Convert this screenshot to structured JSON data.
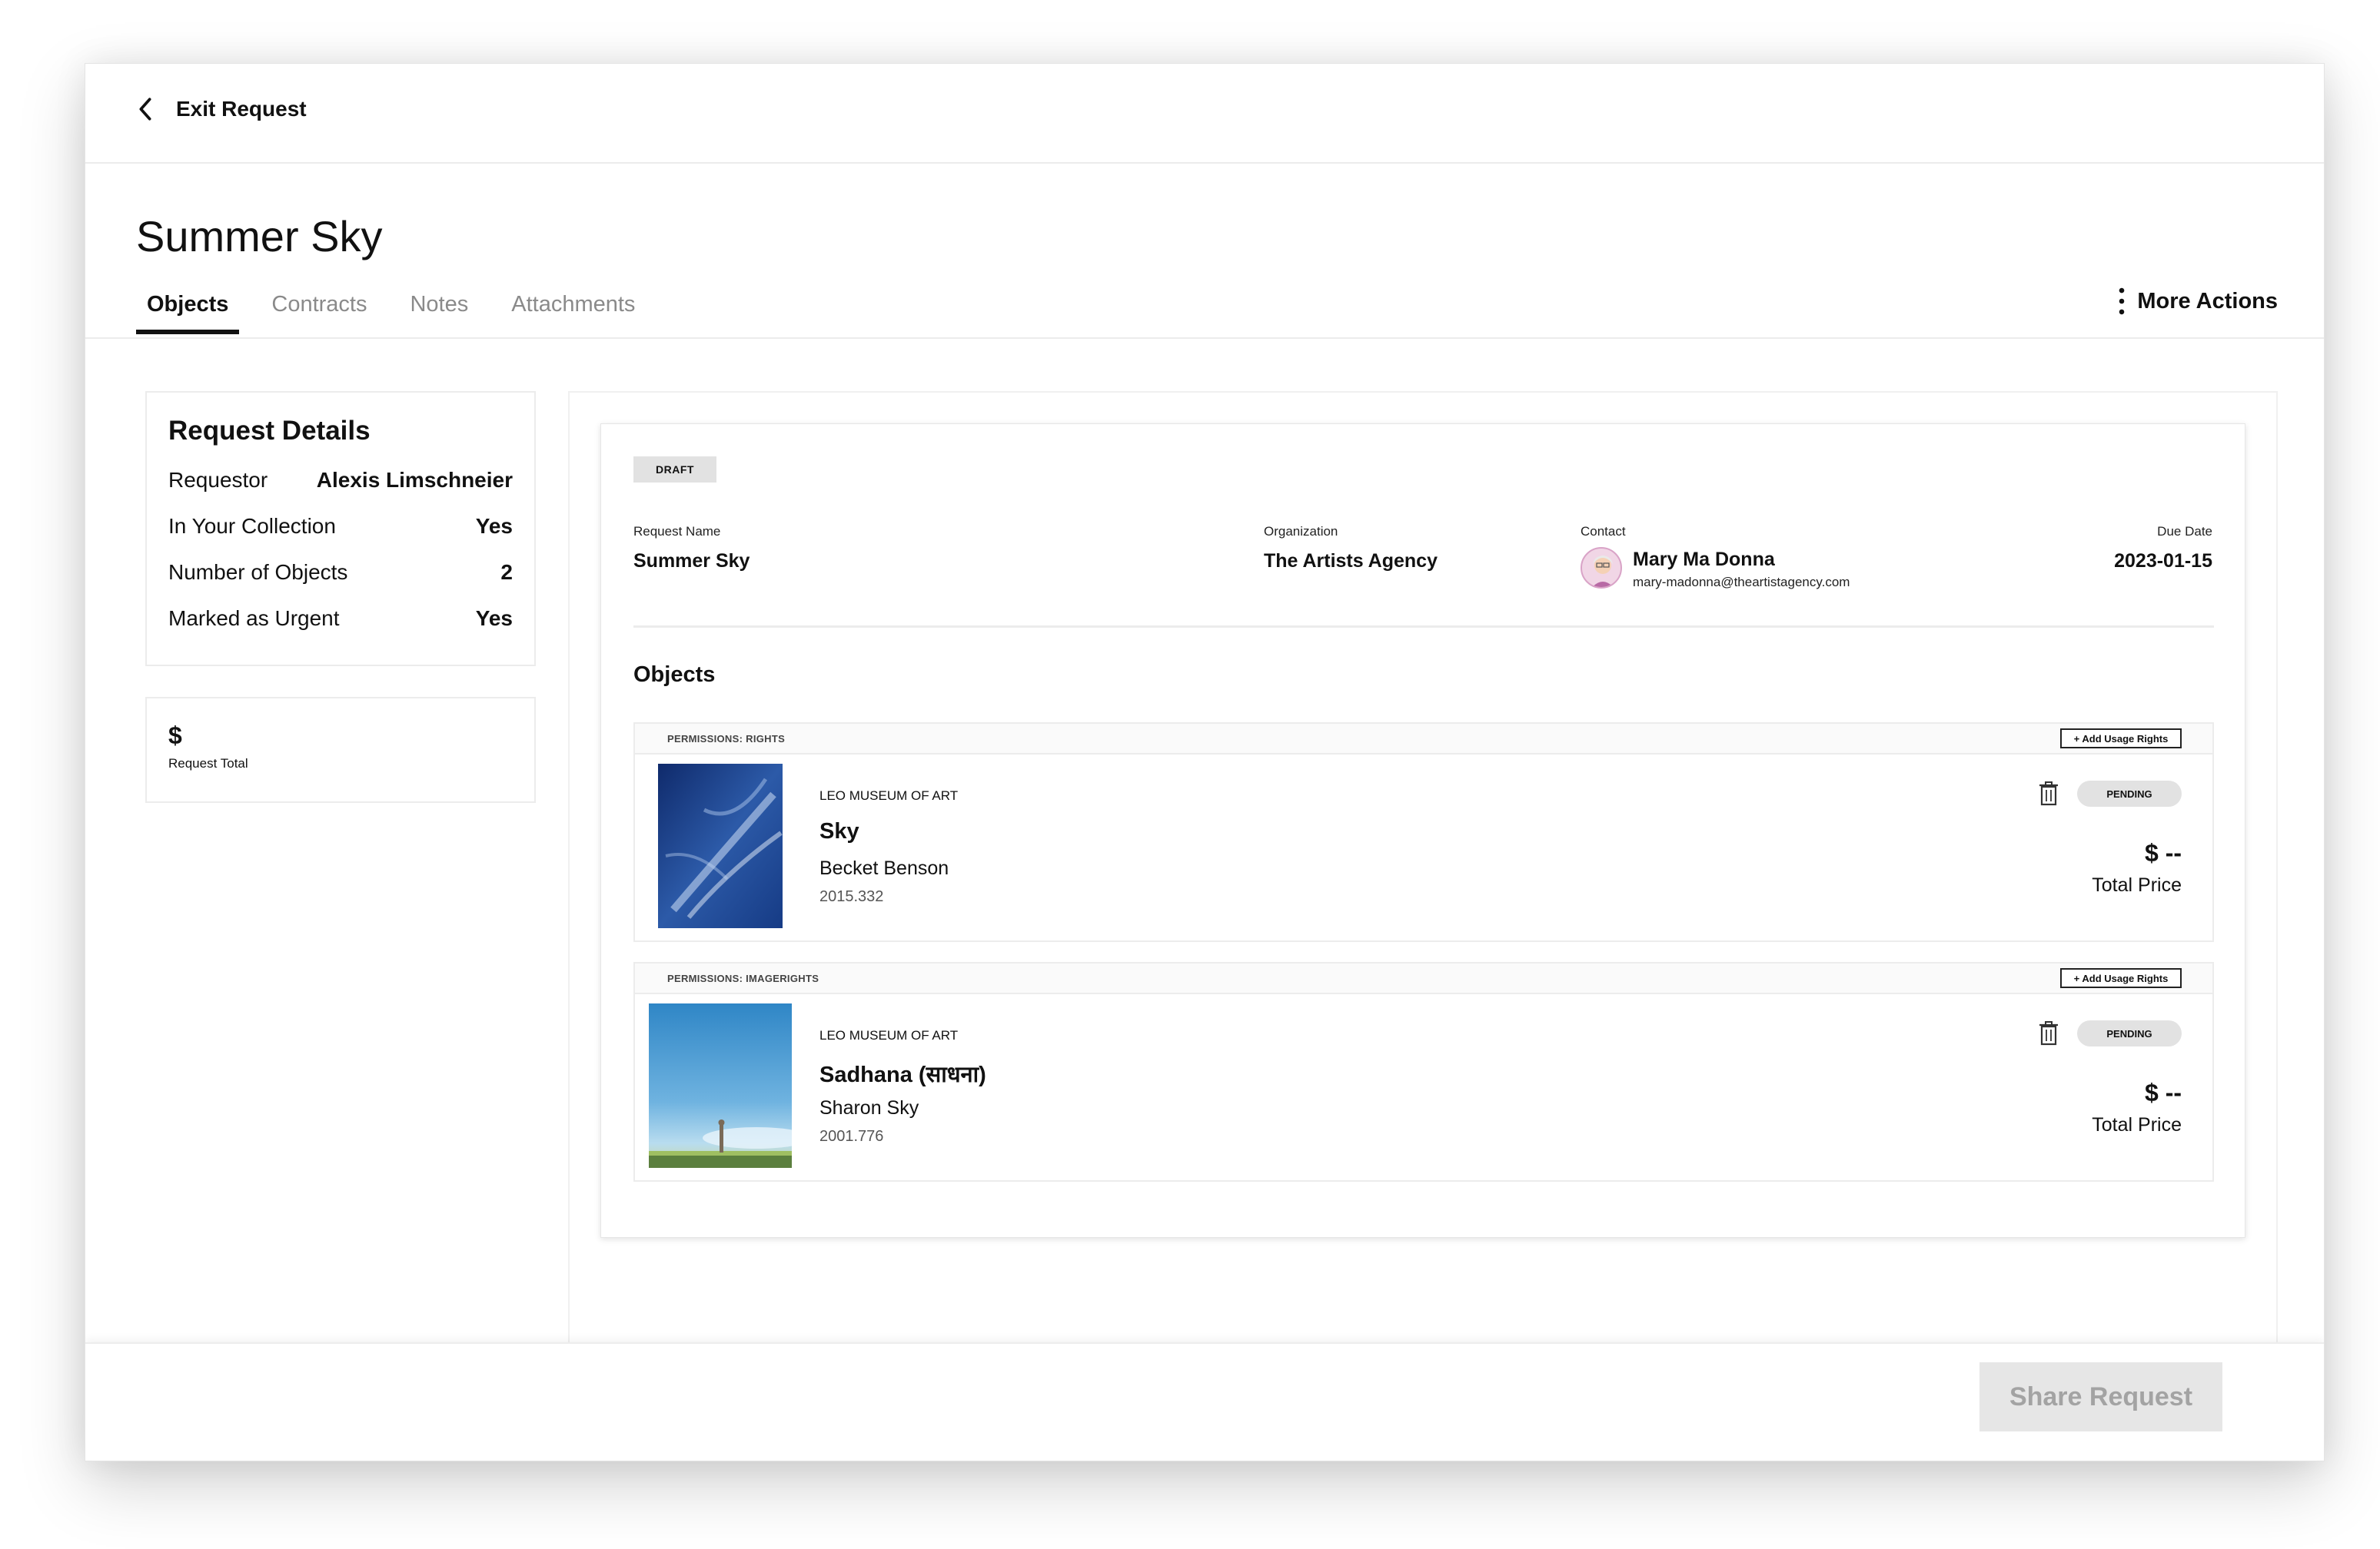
{
  "topbar": {
    "exit_label": "Exit Request"
  },
  "page": {
    "title": "Summer Sky"
  },
  "tabs": [
    {
      "label": "Objects",
      "active": true
    },
    {
      "label": "Contracts",
      "active": false
    },
    {
      "label": "Notes",
      "active": false
    },
    {
      "label": "Attachments",
      "active": false
    }
  ],
  "more_actions_label": "More Actions",
  "details": {
    "title": "Request Details",
    "rows": [
      {
        "label": "Requestor",
        "value": "Alexis Limschneier"
      },
      {
        "label": "In Your Collection",
        "value": "Yes"
      },
      {
        "label": "Number of Objects",
        "value": "2"
      },
      {
        "label": "Marked as Urgent",
        "value": "Yes"
      }
    ]
  },
  "total": {
    "value": "$",
    "label": "Request Total"
  },
  "request": {
    "status": "DRAFT",
    "name_label": "Request Name",
    "name": "Summer Sky",
    "org_label": "Organization",
    "org": "The Artists Agency",
    "contact_label": "Contact",
    "contact_name": "Mary Ma Donna",
    "contact_email": "mary-madonna@theartistagency.com",
    "due_label": "Due Date",
    "due": "2023-01-15"
  },
  "objects_heading": "Objects",
  "objects": [
    {
      "permission": "PERMISSIONS: RIGHTS",
      "add_label": "+ Add Usage Rights",
      "museum": "LEO MUSEUM OF ART",
      "title": "Sky",
      "artist": "Becket Benson",
      "accession": "2015.332",
      "status": "PENDING",
      "price": "$ --",
      "price_label": "Total Price"
    },
    {
      "permission": "PERMISSIONS: IMAGERIGHTS",
      "add_label": "+ Add Usage Rights",
      "museum": "LEO MUSEUM OF ART",
      "title": "Sadhana (साधना)",
      "artist": "Sharon Sky",
      "accession": "2001.776",
      "status": "PENDING",
      "price": "$ --",
      "price_label": "Total Price"
    }
  ],
  "footer": {
    "share_label": "Share Request"
  },
  "colors": {
    "accent": "#111111",
    "badge_bg": "#e2e2e2",
    "disabled_bg": "#e6e6e6",
    "disabled_text": "#a3a3a3"
  },
  "icons": [
    "chevron-left-icon",
    "kebab-menu-icon",
    "trash-icon",
    "avatar"
  ]
}
